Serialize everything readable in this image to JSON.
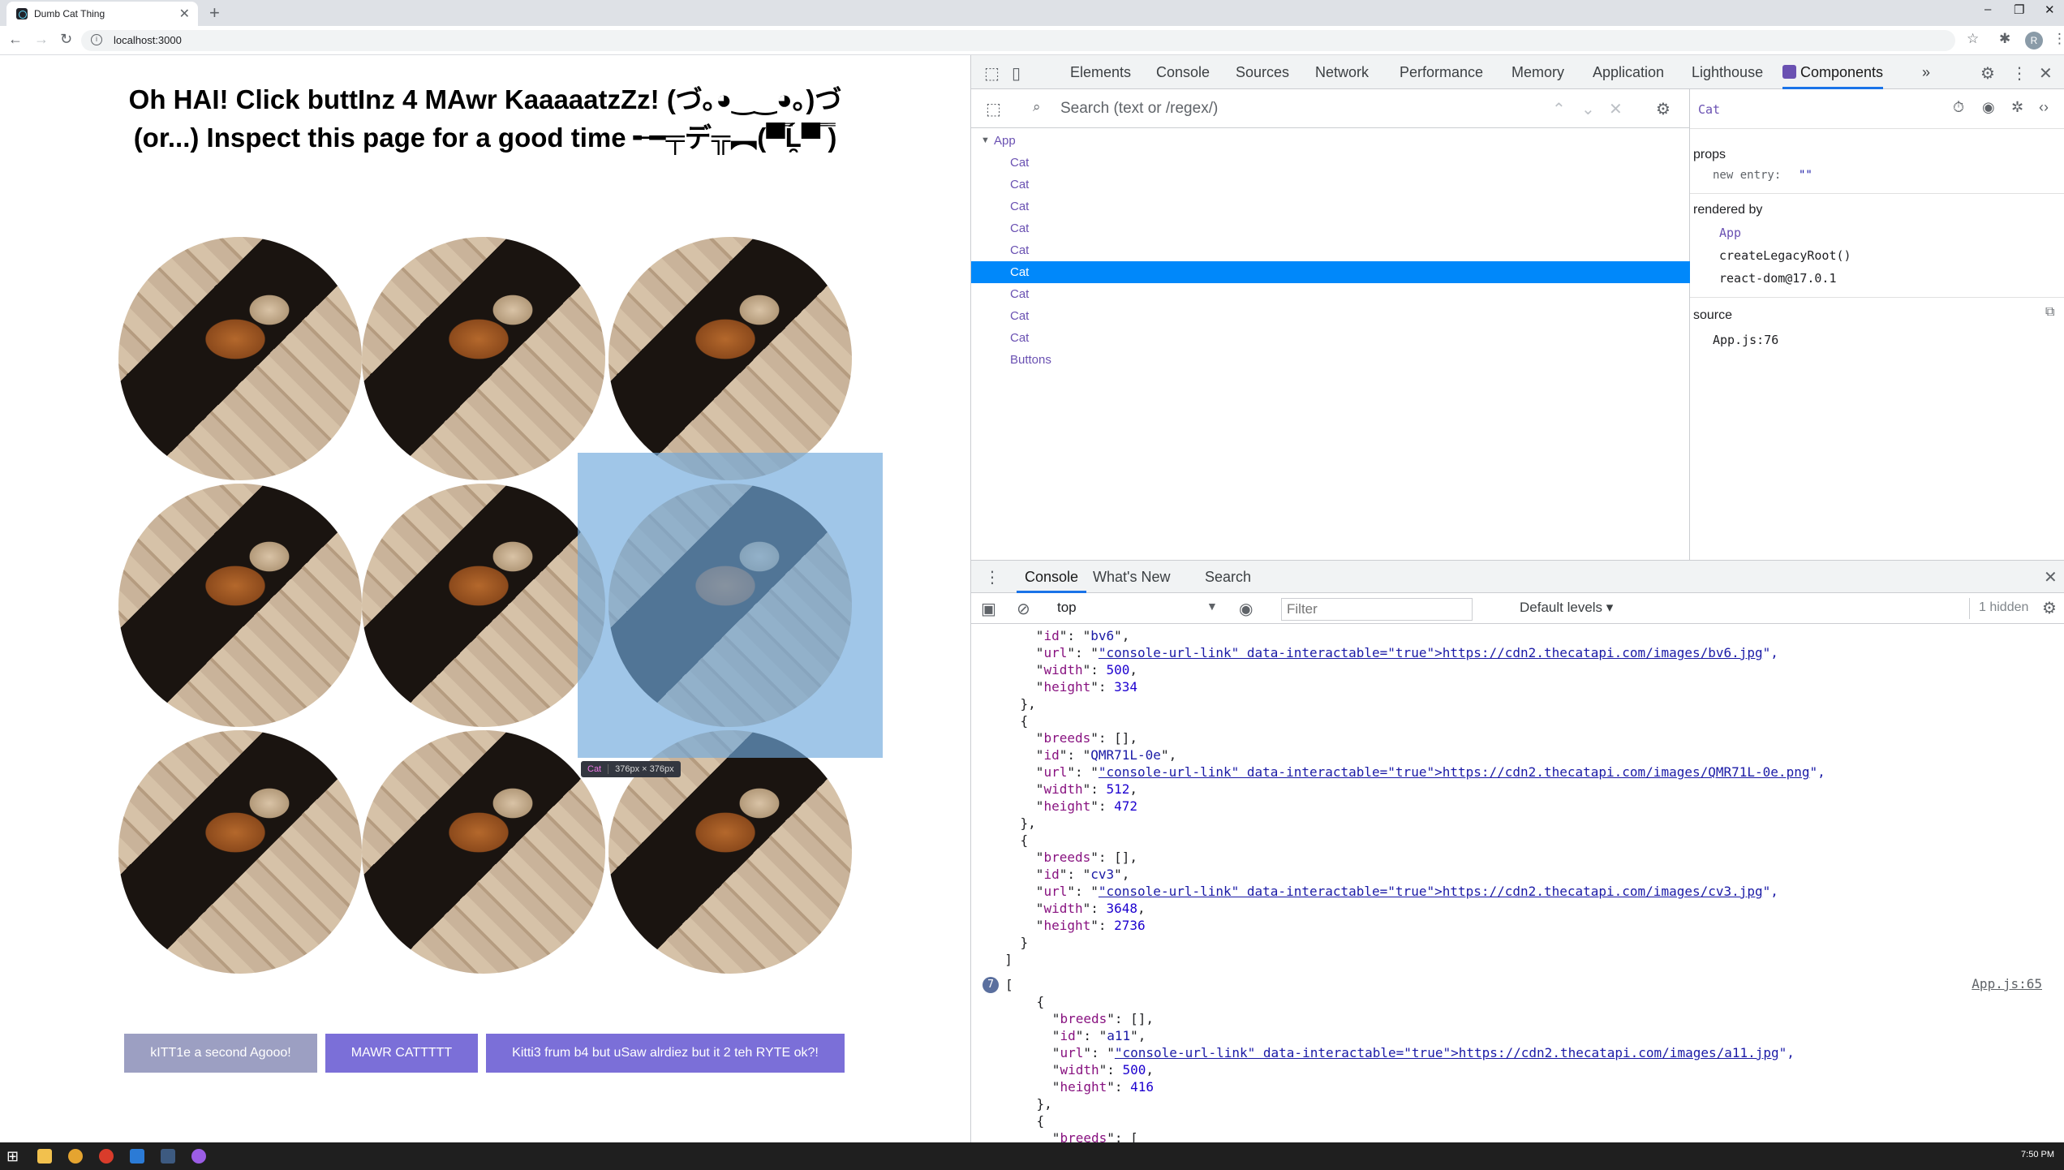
{
  "browser": {
    "tab_title": "Dumb Cat Thing",
    "tab_close": "✕",
    "new_tab": "+",
    "url": "localhost:3000",
    "window_buttons": [
      "–",
      "❐",
      "✕"
    ]
  },
  "page": {
    "heading_line1": "Oh HAI! Click buttInz 4 MAwr KaaaaatzZz! (づ｡◕‿‿◕｡)づ",
    "heading_line2": "(or...) Inspect this page for a good time ╾━╤デ╦︻(▀̿Ĺ̯▀̿ ̿)",
    "buttons": [
      {
        "label": "kITT1e a second Agooo!",
        "color": "#9c9fc2"
      },
      {
        "label": "MAWR CATTTTT",
        "color": "#7b6fd8"
      },
      {
        "label": "Kitti3 frum b4 but uSaw alrdiez but it 2 teh RYTE ok?!",
        "color": "#7b6fd8"
      }
    ],
    "highlight_tooltip": {
      "name": "Cat",
      "size": "376px × 376px"
    }
  },
  "devtools": {
    "tabs": [
      "Elements",
      "Console",
      "Sources",
      "Network",
      "Performance",
      "Memory",
      "Application",
      "Lighthouse",
      "Components"
    ],
    "active_tab": "Components",
    "more": "»",
    "search_placeholder": "Search (text or /regex/)",
    "tree": [
      "App",
      "Cat",
      "Cat",
      "Cat",
      "Cat",
      "Cat",
      "Cat",
      "Cat",
      "Cat",
      "Cat",
      "Buttons"
    ],
    "selected_component": "Cat",
    "props_label": "props",
    "prop_key": "new entry:",
    "prop_value": "\"\"",
    "rendered_by_label": "rendered by",
    "rendered_by": [
      "App",
      "createLegacyRoot()",
      "react-dom@17.0.1"
    ],
    "source_label": "source",
    "source_value": "App.js:76",
    "drawer_tabs": [
      "Console",
      "What's New",
      "Search"
    ],
    "context": "top",
    "filter_placeholder": "Filter",
    "levels": "Default levels ▾",
    "hidden": "1 hidden",
    "log_count": "7",
    "log_source": "App.js:65",
    "console_lines": [
      "      \"id\": \"bv6\",",
      "      \"url\": \"https://cdn2.thecatapi.com/images/bv6.jpg\",",
      "      \"width\": 500,",
      "      \"height\": 334",
      "    },",
      "    {",
      "      \"breeds\": [],",
      "      \"id\": \"QMR71L-0e\",",
      "      \"url\": \"https://cdn2.thecatapi.com/images/QMR71L-0e.png\",",
      "      \"width\": 512,",
      "      \"height\": 472",
      "    },",
      "    {",
      "      \"breeds\": [],",
      "      \"id\": \"cv3\",",
      "      \"url\": \"https://cdn2.thecatapi.com/images/cv3.jpg\",",
      "      \"width\": 3648,",
      "      \"height\": 2736",
      "    }",
      "  ]",
      "[",
      "    {",
      "      \"breeds\": [],",
      "      \"id\": \"a11\",",
      "      \"url\": \"https://cdn2.thecatapi.com/images/a11.jpg\",",
      "      \"width\": 500,",
      "      \"height\": 416",
      "    },",
      "    {",
      "      \"breeds\": ["
    ]
  },
  "taskbar": {
    "clock": "7:50 PM"
  }
}
